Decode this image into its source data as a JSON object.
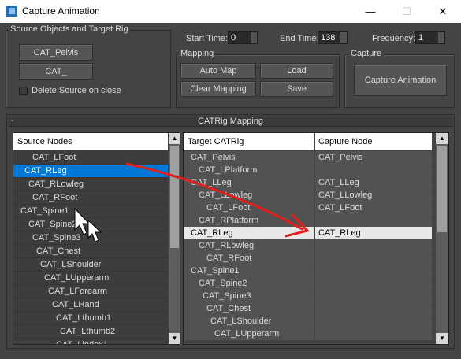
{
  "window": {
    "title": "Capture Animation",
    "minimize": "—",
    "maximize": "☐",
    "close": "✕"
  },
  "source_group": {
    "label": "Source Objects and Target Rig",
    "pelvis_button": "CAT_Pelvis",
    "cat_button": "CAT_",
    "delete_source_label": "Delete Source on close",
    "delete_source_checked": false
  },
  "timing": {
    "start_label": "Start Time:",
    "start_value": "0",
    "end_label": "End Time:",
    "end_value": "138",
    "freq_label": "Frequency:",
    "freq_value": "1"
  },
  "mapping_group": {
    "label": "Mapping",
    "auto_map": "Auto Map",
    "load": "Load",
    "clear": "Clear Mapping",
    "save": "Save"
  },
  "capture_group": {
    "label": "Capture",
    "capture_button": "Capture Animation"
  },
  "catrig_panel": {
    "collapse": "-",
    "title": "CATRig Mapping",
    "source_header": "Source Nodes",
    "source_nodes": [
      {
        "label": "CAT_LFoot",
        "indent": 4
      },
      {
        "label": "CAT_RLeg",
        "indent": 2,
        "selected": true
      },
      {
        "label": "CAT_RLowleg",
        "indent": 3
      },
      {
        "label": "CAT_RFoot",
        "indent": 4
      },
      {
        "label": "CAT_Spine1",
        "indent": 1
      },
      {
        "label": "CAT_Spine2",
        "indent": 3
      },
      {
        "label": "CAT_Spine3",
        "indent": 4
      },
      {
        "label": "CAT_Chest",
        "indent": 5
      },
      {
        "label": "CAT_LShoulder",
        "indent": 6
      },
      {
        "label": "CAT_LUpperarm",
        "indent": 7
      },
      {
        "label": "CAT_LForearm",
        "indent": 8
      },
      {
        "label": "CAT_LHand",
        "indent": 9
      },
      {
        "label": "CAT_Lthumb1",
        "indent": 10
      },
      {
        "label": "CAT_Lthumb2",
        "indent": 11
      },
      {
        "label": "CAT_Lindex1",
        "indent": 10
      }
    ],
    "target_header": "Target CATRig",
    "capture_header": "Capture Node",
    "mappings": [
      {
        "target": "CAT_Pelvis",
        "indent": 1,
        "capture": "CAT_Pelvis"
      },
      {
        "target": "CAT_LPlatform",
        "indent": 3,
        "capture": ""
      },
      {
        "target": "CAT_LLeg",
        "indent": 1,
        "capture": "CAT_LLeg"
      },
      {
        "target": "CAT_LLowleg",
        "indent": 3,
        "capture": "CAT_LLowleg"
      },
      {
        "target": "CAT_LFoot",
        "indent": 5,
        "capture": "CAT_LFoot"
      },
      {
        "target": "CAT_RPlatform",
        "indent": 3,
        "capture": ""
      },
      {
        "target": "CAT_RLeg",
        "indent": 1,
        "capture": "CAT_RLeg",
        "highlighted": true
      },
      {
        "target": "CAT_RLowleg",
        "indent": 3,
        "capture": ""
      },
      {
        "target": "CAT_RFoot",
        "indent": 5,
        "capture": ""
      },
      {
        "target": "CAT_Spine1",
        "indent": 1,
        "capture": ""
      },
      {
        "target": "CAT_Spine2",
        "indent": 3,
        "capture": ""
      },
      {
        "target": "CAT_Spine3",
        "indent": 4,
        "capture": ""
      },
      {
        "target": "CAT_Chest",
        "indent": 5,
        "capture": ""
      },
      {
        "target": "CAT_LShoulder",
        "indent": 6,
        "capture": ""
      },
      {
        "target": "CAT_LUpperarm",
        "indent": 7,
        "capture": ""
      }
    ]
  },
  "colors": {
    "bg": "#444444",
    "selection": "#0078d7",
    "annotation": "#e0201c"
  }
}
